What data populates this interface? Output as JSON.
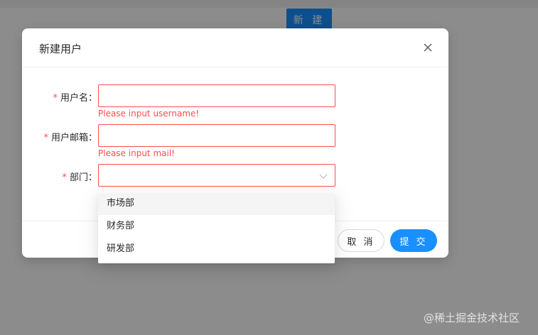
{
  "page": {
    "new_button_label": "新 建"
  },
  "modal": {
    "title": "新建用户",
    "fields": [
      {
        "label": "用户名",
        "required_mark": "*",
        "colon": "：",
        "value": "",
        "error": "Please input username!"
      },
      {
        "label": "用户邮箱",
        "required_mark": "*",
        "colon": "：",
        "value": "",
        "error": "Please input mail!"
      },
      {
        "label": "部门",
        "required_mark": "*",
        "colon": "：",
        "value": "",
        "error": ""
      }
    ],
    "cancel_label": "取 消",
    "submit_label": "提 交"
  },
  "dropdown": {
    "options": [
      "市场部",
      "财务部",
      "研发部"
    ],
    "highlighted_index": 0
  },
  "watermark": "@稀土掘金技术社区",
  "colors": {
    "primary": "#1890ff",
    "error": "#ff4d4f",
    "mask": "rgba(0,0,0,0.45)"
  },
  "icons": {
    "close": "close-icon",
    "select_arrow": "chevron-down-icon"
  }
}
